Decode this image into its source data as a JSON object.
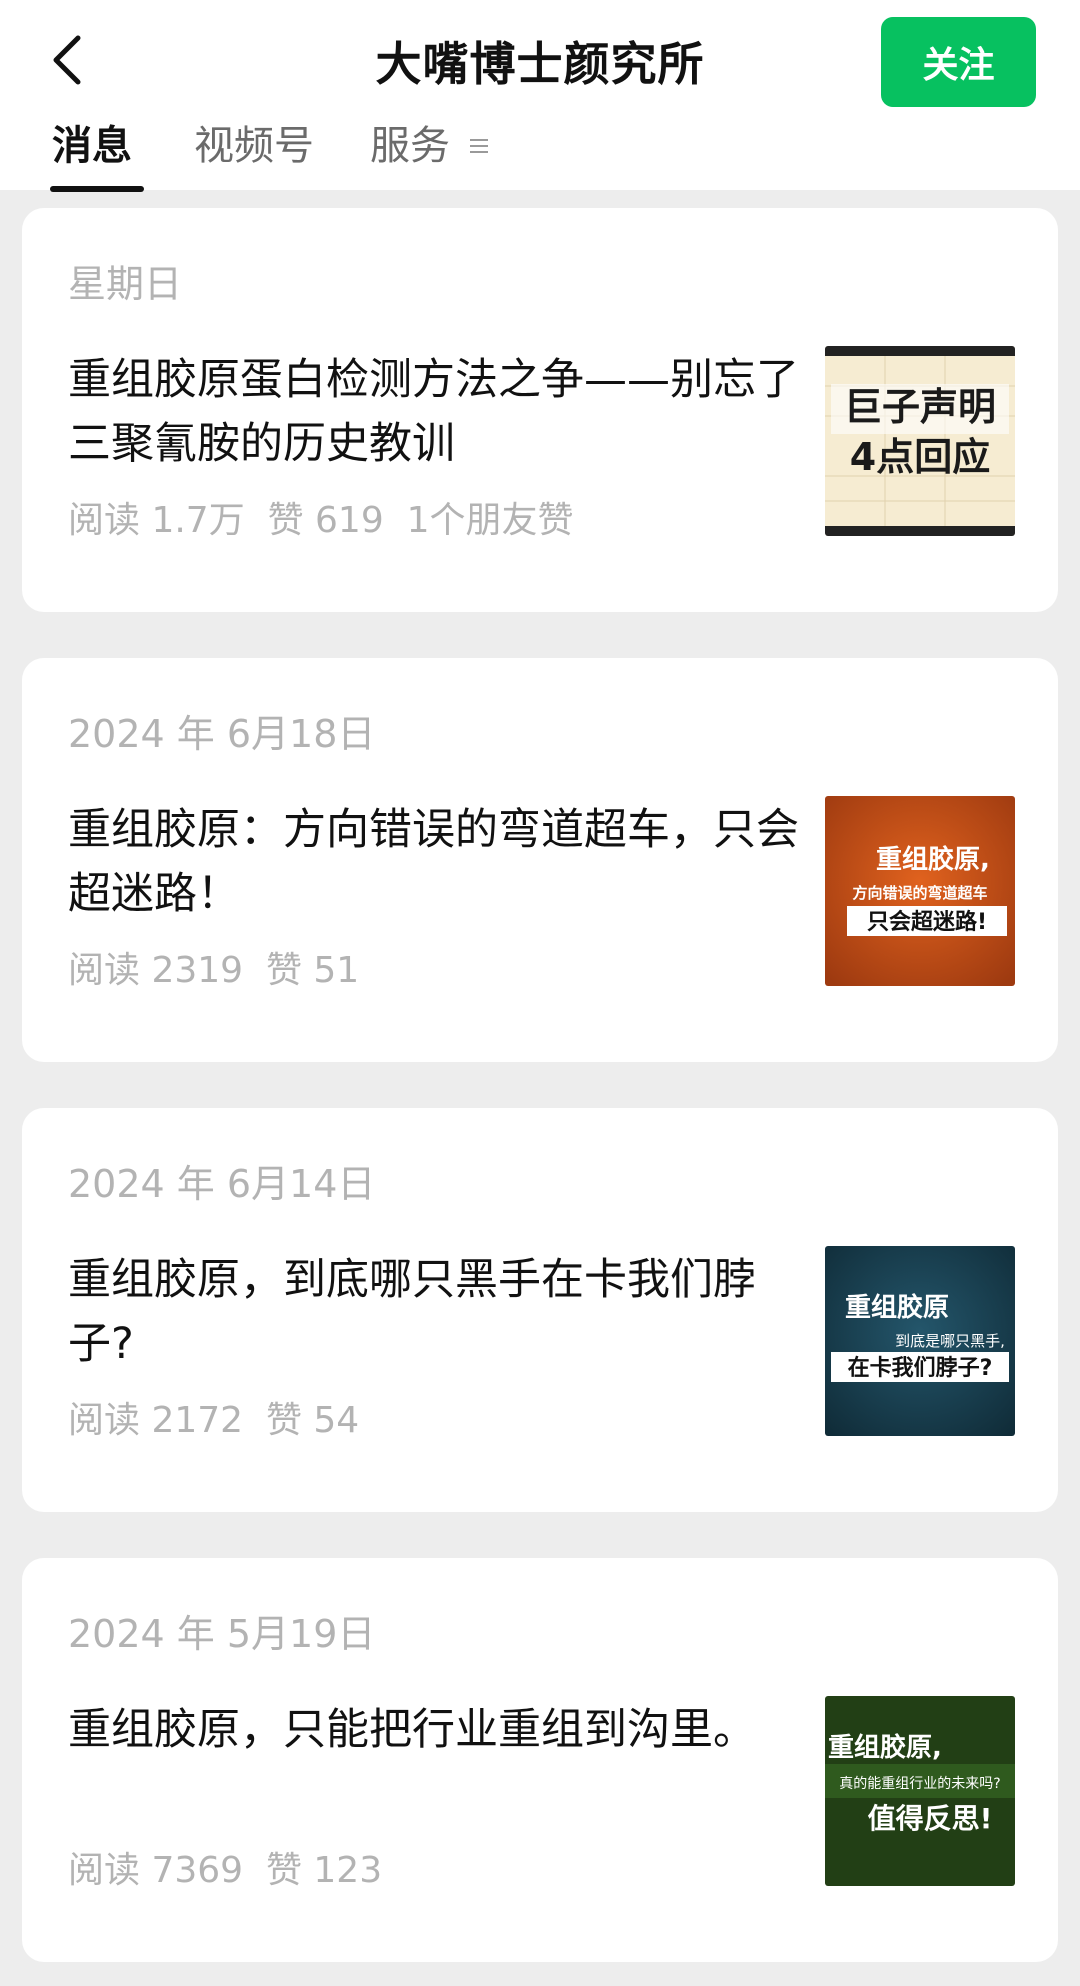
{
  "header": {
    "title": "大嘴博士颜究所",
    "follow_label": "关注"
  },
  "tabs": [
    {
      "label": "消息"
    },
    {
      "label": "视频号"
    },
    {
      "label": "服务"
    }
  ],
  "articles": [
    {
      "date": "星期日",
      "title": "重组胶原蛋白检测方法之争——别忘了三聚氰胺的历史教训",
      "stats": "阅读 1.7万  赞 619  1个朋友赞",
      "thumb": {
        "lines": [
          "巨子声明",
          "4点回应"
        ],
        "bg": "#f4e7c6",
        "accent": "#1a1a1a"
      }
    },
    {
      "date": "2024 年 6月18日",
      "title": "重组胶原：方向错误的弯道超车，只会超迷路！",
      "stats": "阅读 2319  赞 51",
      "thumb": {
        "lines": [
          "重组胶原,",
          "方向错误的弯道超车",
          "只会超迷路!"
        ],
        "bg": "#c8521c",
        "accent": "#ffffff"
      }
    },
    {
      "date": "2024 年 6月14日",
      "title": "重组胶原，到底哪只黑手在卡我们脖子?",
      "stats": "阅读 2172  赞 54",
      "thumb": {
        "lines": [
          "重组胶原",
          "到底是哪只黑手,",
          "在卡我们脖子?"
        ],
        "bg": "#163a4a",
        "accent": "#ffffff"
      }
    },
    {
      "date": "2024 年 5月19日",
      "title": "重组胶原，只能把行业重组到沟里。",
      "stats": "阅读 7369  赞 123",
      "thumb": {
        "lines": [
          "重组胶原,",
          "真的能重组行业的未来吗?",
          "值得反思!"
        ],
        "bg": "#1f3d14",
        "accent": "#ffffff"
      }
    }
  ],
  "colors": {
    "brand_green": "#07c160",
    "background": "#ededed",
    "meta_gray": "#b3b3b3"
  },
  "icons": {
    "back": "back-arrow-icon",
    "menu": "menu-lines-icon"
  }
}
